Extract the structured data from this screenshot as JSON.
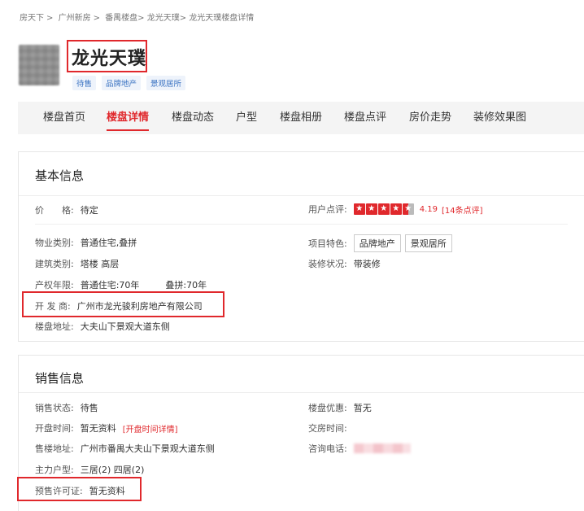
{
  "breadcrumb": {
    "items": [
      "房天下",
      "广州新房",
      "番禺楼盘",
      "龙光天璞",
      "龙光天璞楼盘详情"
    ],
    "sep1": ">",
    "sep2": ">",
    "sep3": ">",
    "sep4": ">"
  },
  "header": {
    "title": "龙光天璞",
    "tags": [
      "待售",
      "品牌地产",
      "景观居所"
    ]
  },
  "nav": {
    "tabs": [
      "楼盘首页",
      "楼盘详情",
      "楼盘动态",
      "户型",
      "楼盘相册",
      "楼盘点评",
      "房价走势",
      "装修效果图"
    ],
    "active_index": 1
  },
  "basic": {
    "title": "基本信息",
    "price_label": "价　　格:",
    "price_value": "待定",
    "rating_label": "用户点评:",
    "rating_stars": 4.5,
    "rating_score": "4.19",
    "rating_count": "[14条点评]",
    "type_label": "物业类别:",
    "type_value": "普通住宅,叠拼",
    "feature_label": "项目特色:",
    "features": [
      "品牌地产",
      "景观居所"
    ],
    "building_label": "建筑类别:",
    "building_value": "塔楼 高层",
    "decor_label": "装修状况:",
    "decor_value": "带装修",
    "term_label": "产权年限:",
    "term_value1": "普通住宅:70年",
    "term_value2": "叠拼:70年",
    "dev_label": "开 发 商:",
    "dev_value": "广州市龙光骏利房地产有限公司",
    "addr_label": "楼盘地址:",
    "addr_value": "大夫山下景观大道东侧"
  },
  "sales": {
    "title": "销售信息",
    "status_label": "销售状态:",
    "status_value": "待售",
    "discount_label": "楼盘优惠:",
    "discount_value": "暂无",
    "open_label": "开盘时间:",
    "open_value": "暂无资料",
    "open_link": "[开盘时间详情]",
    "delivery_label": "交房时间:",
    "delivery_value": "",
    "office_label": "售楼地址:",
    "office_value": "广州市番禺大夫山下景观大道东侧",
    "phone_label": "咨询电话:",
    "main_label": "主力户型:",
    "main_value": "三居(2) 四居(2)",
    "permit_label": "预售许可证:",
    "permit_value": "暂无资料"
  },
  "colors": {
    "accent": "#e0282c",
    "tag_blue": "#3b73c2",
    "nav_bg": "#f4f4f4"
  }
}
